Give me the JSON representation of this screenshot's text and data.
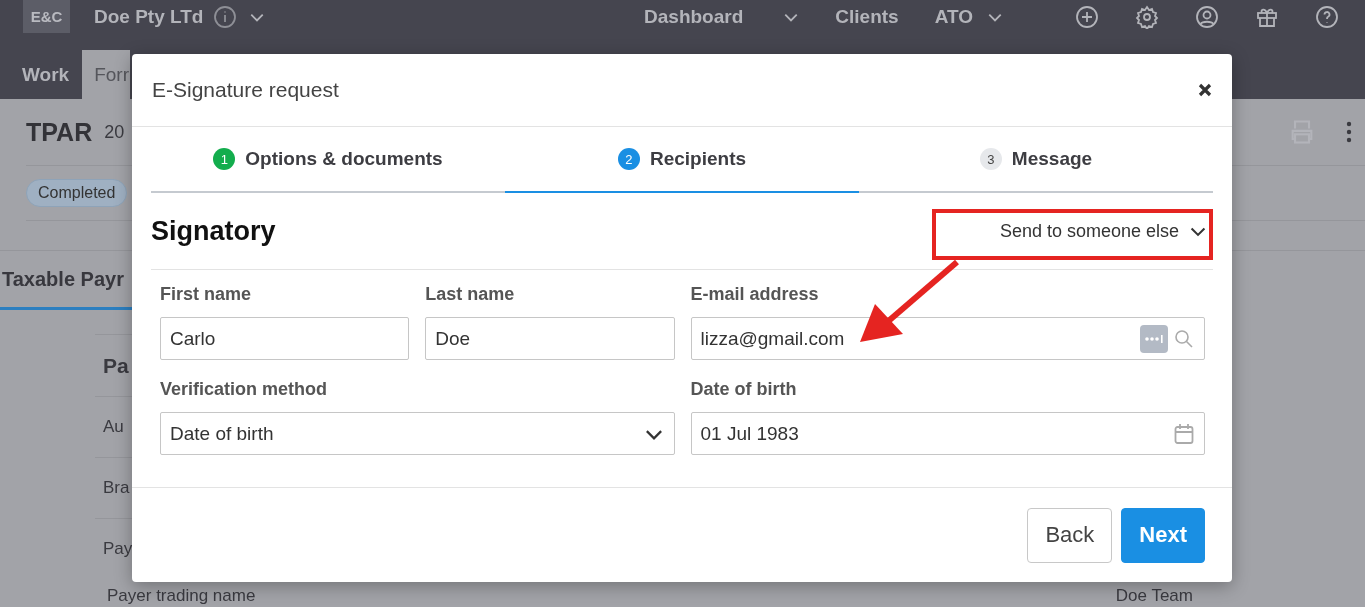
{
  "header": {
    "logo": "E&C",
    "company": "Doe Pty LTd",
    "nav": [
      {
        "label": "Dashboard",
        "dropdown": true
      },
      {
        "label": "Clients",
        "dropdown": false
      },
      {
        "label": "ATO",
        "dropdown": true
      }
    ],
    "tabs": [
      {
        "label": "Work",
        "selected": false
      },
      {
        "label": "Forr",
        "selected": true
      }
    ]
  },
  "page": {
    "title": "TPAR",
    "year": "20",
    "status": "Completed",
    "section_tab": "Taxable Payr",
    "section_heading": "Pa",
    "rows": [
      "Au",
      "Bra",
      "Pay"
    ],
    "bottom_row": {
      "label": "Payer trading name",
      "value": "Doe Team"
    }
  },
  "dialog": {
    "title": "E-Signature request",
    "steps": [
      {
        "number": "1",
        "label": "Options & documents",
        "completed": true,
        "selected": false
      },
      {
        "number": "2",
        "label": "Recipients",
        "completed": false,
        "selected": true
      },
      {
        "number": "3",
        "label": "Message",
        "completed": false,
        "selected": false
      }
    ],
    "section_title": "Signatory",
    "send_option": "Send to someone else",
    "fields": [
      {
        "label": "First name",
        "value": "Carlo",
        "kind": "text"
      },
      {
        "label": "Last name",
        "value": "Doe",
        "kind": "text"
      },
      {
        "label": "E-mail address",
        "value": "lizza@gmail.com",
        "kind": "lookup"
      },
      {
        "label": "Verification method",
        "value": "Date of birth",
        "kind": "select"
      },
      {
        "label": "Date of birth",
        "value": "01 Jul 1983",
        "kind": "date"
      }
    ],
    "buttons": [
      {
        "label": "Back",
        "primary": false
      },
      {
        "label": "Next",
        "primary": true
      }
    ]
  }
}
